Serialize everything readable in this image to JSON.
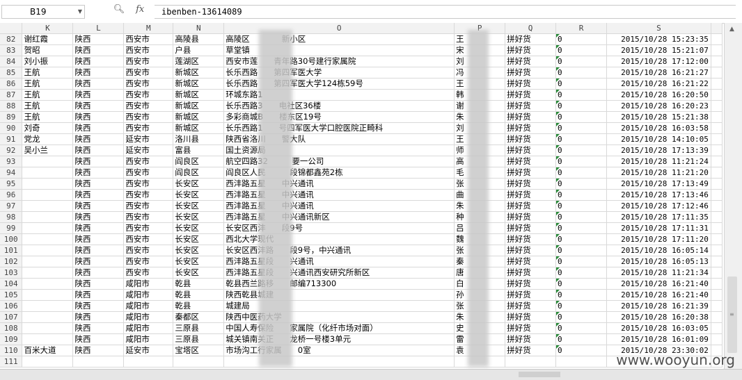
{
  "formula_bar": {
    "cell_ref": "B19",
    "zoom_icon": "magnifier-icon",
    "fx": "fx",
    "value": "ibenben-13614089"
  },
  "columns": [
    "K",
    "L",
    "M",
    "N",
    "O",
    "P",
    "Q",
    "R",
    "S"
  ],
  "rows": [
    {
      "n": "82",
      "k": "谢红霞",
      "l": "陕西",
      "m": "西安市",
      "nn": "高陵县",
      "o": "高陵区　　　　新小区",
      "p": "王",
      "q": "拼好货",
      "r": "0",
      "s": "2015/10/28 15:23:35"
    },
    {
      "n": "83",
      "k": "贺昭",
      "l": "陕西",
      "m": "西安市",
      "nn": "户县",
      "o": "草堂镇",
      "p": "宋",
      "q": "拼好货",
      "r": "0",
      "s": "2015/10/28 15:21:07"
    },
    {
      "n": "84",
      "k": "刘小振",
      "l": "陕西",
      "m": "西安市",
      "nn": "莲湖区",
      "o": "西安市莲　　青年路30号建行家属院",
      "p": "刘",
      "q": "拼好货",
      "r": "0",
      "s": "2015/10/28 17:12:00"
    },
    {
      "n": "85",
      "k": "王航",
      "l": "陕西",
      "m": "西安市",
      "nn": "新城区",
      "o": "长乐西路　　第四军医大学",
      "p": "冯",
      "q": "拼好货",
      "r": "0",
      "s": "2015/10/28 16:21:27"
    },
    {
      "n": "86",
      "k": "王航",
      "l": "陕西",
      "m": "西安市",
      "nn": "新城区",
      "o": "长乐西路　　第四军医大学124栋59号",
      "p": "王",
      "q": "拼好货",
      "r": "0",
      "s": "2015/10/28 16:21:22"
    },
    {
      "n": "87",
      "k": "王航",
      "l": "陕西",
      "m": "西安市",
      "nn": "新城区",
      "o": "环城东路1",
      "p": "韩",
      "q": "拼好货",
      "r": "0",
      "s": "2015/10/28 16:20:50"
    },
    {
      "n": "88",
      "k": "王航",
      "l": "陕西",
      "m": "西安市",
      "nn": "新城区",
      "o": "长乐西路3　　电社区36楼",
      "p": "谢",
      "q": "拼好货",
      "r": "0",
      "s": "2015/10/28 16:20:23"
    },
    {
      "n": "89",
      "k": "王航",
      "l": "陕西",
      "m": "西安市",
      "nn": "新城区",
      "o": "多彩商城B　　楼东区19号",
      "p": "朱",
      "q": "拼好货",
      "r": "0",
      "s": "2015/10/28 15:21:38"
    },
    {
      "n": "90",
      "k": "刘奇",
      "l": "陕西",
      "m": "西安市",
      "nn": "新城区",
      "o": "长乐西路1　　号四军医大学口腔医院正畸科",
      "p": "刘",
      "q": "拼好货",
      "r": "0",
      "s": "2015/10/28 16:03:58"
    },
    {
      "n": "91",
      "k": "党龙",
      "l": "陕西",
      "m": "延安市",
      "nn": "洛川县",
      "o": "陕西省洛川　　警大队",
      "p": "王",
      "q": "拼好货",
      "r": "0",
      "s": "2015/10/28 14:10:05"
    },
    {
      "n": "92",
      "k": "吴小兰",
      "l": "陕西",
      "m": "延安市",
      "nn": "富县",
      "o": "国土资源局",
      "p": "师",
      "q": "拼好货",
      "r": "0",
      "s": "2015/10/28 17:13:39"
    },
    {
      "n": "93",
      "k": "",
      "l": "陕西",
      "m": "西安市",
      "nn": "阎良区",
      "o": "航空四路32　　　要一公司",
      "p": "高",
      "q": "拼好货",
      "r": "0",
      "s": "2015/10/28 11:21:24"
    },
    {
      "n": "94",
      "k": "",
      "l": "陕西",
      "m": "西安市",
      "nn": "阎良区",
      "o": "阎良区人民　　　段锦都鑫苑2栋",
      "p": "毛",
      "q": "拼好货",
      "r": "0",
      "s": "2015/10/28 11:21:20"
    },
    {
      "n": "95",
      "k": "",
      "l": "陕西",
      "m": "西安市",
      "nn": "长安区",
      "o": "西沣路五星　　中兴通讯",
      "p": "张",
      "q": "拼好货",
      "r": "0",
      "s": "2015/10/28 17:13:49"
    },
    {
      "n": "96",
      "k": "",
      "l": "陕西",
      "m": "西安市",
      "nn": "长安区",
      "o": "西沣路五星　　中兴通讯",
      "p": "曲",
      "q": "拼好货",
      "r": "0",
      "s": "2015/10/28 17:13:46"
    },
    {
      "n": "97",
      "k": "",
      "l": "陕西",
      "m": "西安市",
      "nn": "长安区",
      "o": "西沣路五星　　中兴通讯",
      "p": "朱",
      "q": "拼好货",
      "r": "0",
      "s": "2015/10/28 17:12:46"
    },
    {
      "n": "98",
      "k": "",
      "l": "陕西",
      "m": "西安市",
      "nn": "长安区",
      "o": "西沣路五星　　中兴通讯新区",
      "p": "种",
      "q": "拼好货",
      "r": "0",
      "s": "2015/10/28 17:11:35"
    },
    {
      "n": "99",
      "k": "",
      "l": "陕西",
      "m": "西安市",
      "nn": "长安区",
      "o": "长安区西沣　　段9号",
      "p": "吕",
      "q": "拼好货",
      "r": "0",
      "s": "2015/10/28 17:11:31"
    },
    {
      "n": "100",
      "k": "",
      "l": "陕西",
      "m": "西安市",
      "nn": "长安区",
      "o": "西北大学现代",
      "p": "魏",
      "q": "拼好货",
      "r": "0",
      "s": "2015/10/28 17:11:20"
    },
    {
      "n": "101",
      "k": "",
      "l": "陕西",
      "m": "西安市",
      "nn": "长安区",
      "o": "长安区西沣路　　段9号，中兴通讯",
      "p": "张",
      "q": "拼好货",
      "r": "0",
      "s": "2015/10/28 16:05:14"
    },
    {
      "n": "102",
      "k": "",
      "l": "陕西",
      "m": "西安市",
      "nn": "长安区",
      "o": "西沣路五星段　　兴通讯",
      "p": "秦",
      "q": "拼好货",
      "r": "0",
      "s": "2015/10/28 16:05:13"
    },
    {
      "n": "103",
      "k": "",
      "l": "陕西",
      "m": "西安市",
      "nn": "长安区",
      "o": "西沣路五星段　　兴通讯西安研究所新区",
      "p": "唐",
      "q": "拼好货",
      "r": "0",
      "s": "2015/10/28 11:21:34"
    },
    {
      "n": "104",
      "k": "",
      "l": "陕西",
      "m": "咸阳市",
      "nn": "乾县",
      "o": "乾县西兰路移　　邮编713300",
      "p": "白",
      "q": "拼好货",
      "r": "0",
      "s": "2015/10/28 16:21:40"
    },
    {
      "n": "105",
      "k": "",
      "l": "陕西",
      "m": "咸阳市",
      "nn": "乾县",
      "o": "陕西乾县城建",
      "p": "孙",
      "q": "拼好货",
      "r": "0",
      "s": "2015/10/28 16:21:40"
    },
    {
      "n": "106",
      "k": "",
      "l": "陕西",
      "m": "咸阳市",
      "nn": "乾县",
      "o": "城建局",
      "p": "张",
      "q": "拼好货",
      "r": "0",
      "s": "2015/10/28 16:21:39"
    },
    {
      "n": "107",
      "k": "",
      "l": "陕西",
      "m": "咸阳市",
      "nn": "秦都区",
      "o": "陕西中医药大学",
      "p": "朱",
      "q": "拼好货",
      "r": "0",
      "s": "2015/10/28 16:20:38"
    },
    {
      "n": "108",
      "k": "",
      "l": "陕西",
      "m": "咸阳市",
      "nn": "三原县",
      "o": "中国人寿保险　　家属院（化纤市场对面）",
      "p": "史",
      "q": "拼好货",
      "r": "0",
      "s": "2015/10/28 16:03:05"
    },
    {
      "n": "109",
      "k": "",
      "l": "陕西",
      "m": "咸阳市",
      "nn": "三原县",
      "o": "城关镇南关正　　龙桥一号楼3单元",
      "p": "雷",
      "q": "拼好货",
      "r": "0",
      "s": "2015/10/28 16:01:09"
    },
    {
      "n": "110",
      "k": "百米大道",
      "l": "陕西",
      "m": "延安市",
      "nn": "宝塔区",
      "o": "市场沟工行家属　　0室",
      "p": "袁",
      "q": "拼好货",
      "r": "0",
      "s": "2015/10/28 23:30:02"
    },
    {
      "n": "111",
      "k": "",
      "l": "",
      "m": "",
      "nn": "",
      "o": "",
      "p": "",
      "q": "",
      "r": "",
      "s": ""
    }
  ],
  "watermark": "www.wooyun.org"
}
